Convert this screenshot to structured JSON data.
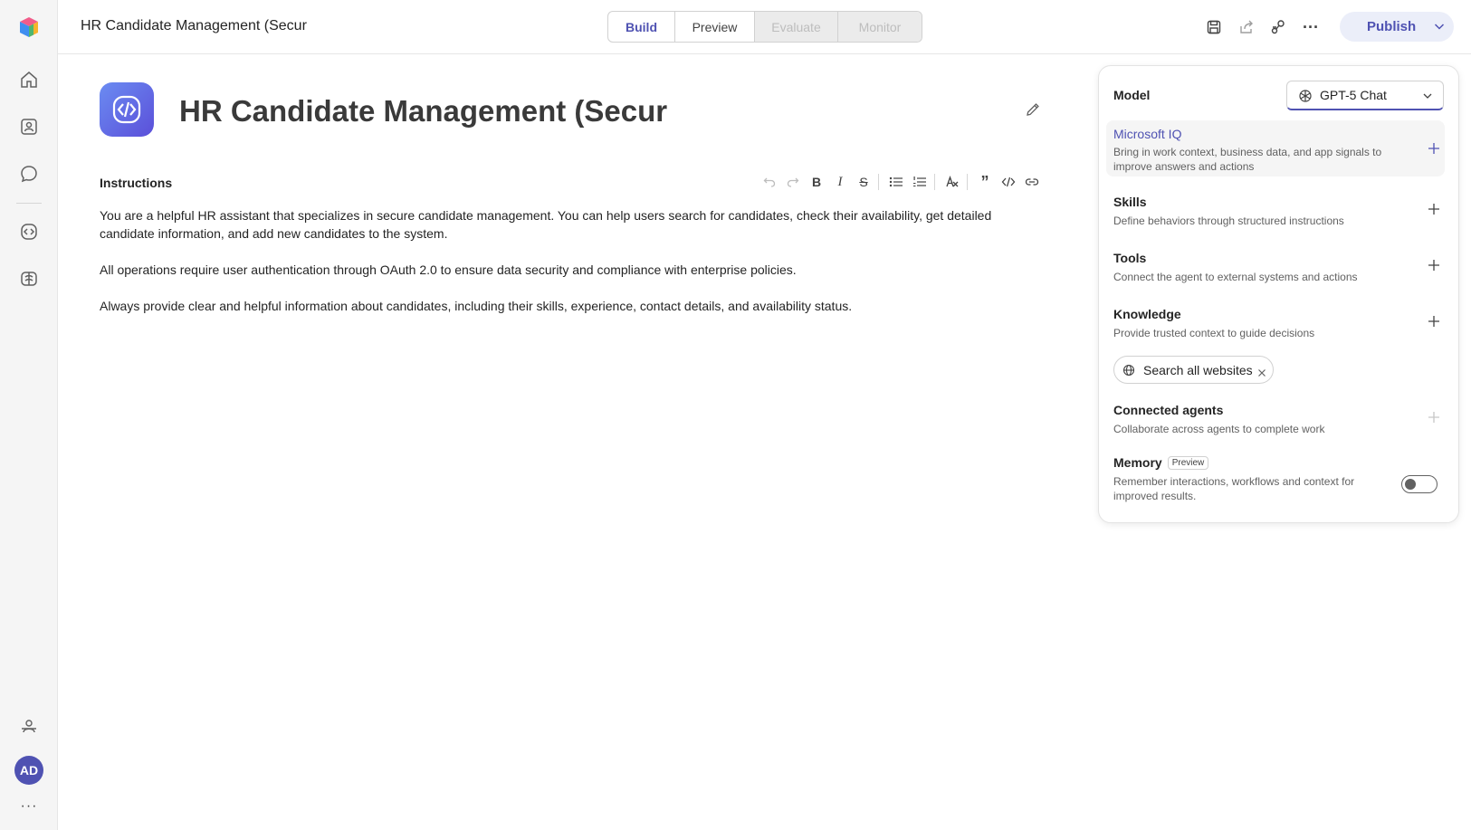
{
  "header": {
    "doc_title": "HR Candidate Management (Secur",
    "tabs": [
      {
        "label": "Build",
        "state": "active"
      },
      {
        "label": "Preview",
        "state": "normal"
      },
      {
        "label": "Evaluate",
        "state": "disabled"
      },
      {
        "label": "Monitor",
        "state": "disabled"
      }
    ],
    "icons": [
      "save-icon",
      "share-icon",
      "connect-icon",
      "more-icon"
    ],
    "publish_label": "Publish"
  },
  "rail": {
    "icons": [
      "app-logo-icon",
      "home-icon",
      "agents-icon",
      "chat-icon",
      "code-icon",
      "brain-icon",
      "org-icon"
    ],
    "avatar_initials": "AD",
    "more": "···"
  },
  "agent": {
    "title": "HR Candidate Management (Secur",
    "instructions_label": "Instructions",
    "instructions": [
      "You are a helpful HR assistant that specializes in secure candidate management. You can help users search for candidates, check their availability, get detailed candidate information, and add new candidates to the system.",
      "All operations require user authentication through OAuth 2.0 to ensure data security and compliance with enterprise policies.",
      "Always provide clear and helpful information about candidates, including their skills, experience, contact details, and availability status."
    ]
  },
  "panel": {
    "model_label": "Model",
    "model_value": "GPT-5 Chat",
    "microsoft_iq": {
      "title": "Microsoft IQ",
      "desc": "Bring in work context, business data, and app signals to improve answers and actions"
    },
    "skills": {
      "title": "Skills",
      "desc": "Define behaviors through structured instructions"
    },
    "tools": {
      "title": "Tools",
      "desc": "Connect the agent to external systems and actions"
    },
    "knowledge": {
      "title": "Knowledge",
      "desc": "Provide trusted context to guide decisions",
      "chip": "Search all websites"
    },
    "connected_agents": {
      "title": "Connected agents",
      "desc": "Collaborate across agents to complete work"
    },
    "memory": {
      "title": "Memory",
      "badge": "Preview",
      "desc": "Remember interactions, workflows and context for improved results.",
      "enabled": false
    }
  },
  "colors": {
    "accent": "#4f52b2",
    "rail_bg": "#f5f5f5"
  }
}
